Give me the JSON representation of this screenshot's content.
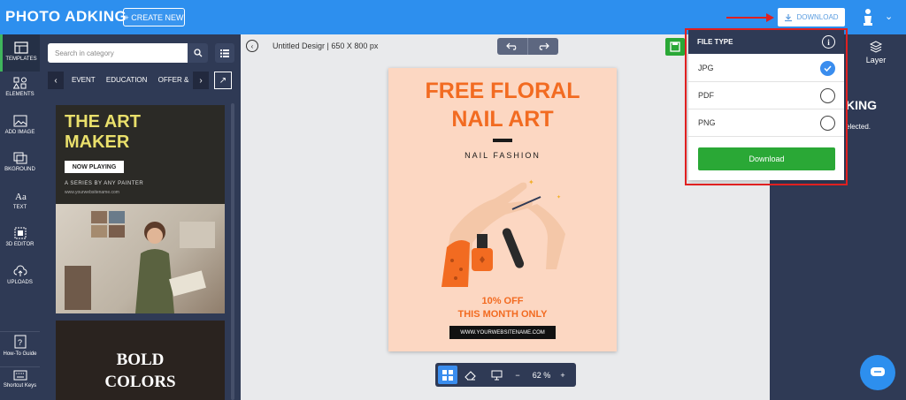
{
  "topbar": {
    "logo": "PHOTO ADKING",
    "create_new": "+ CREATE NEW",
    "download": "DOWNLOAD"
  },
  "leftnav": {
    "items": [
      {
        "label": "TEMPLATES",
        "icon": "templates-icon"
      },
      {
        "label": "ELEMENTS",
        "icon": "elements-icon"
      },
      {
        "label": "ADD IMAGE",
        "icon": "image-icon"
      },
      {
        "label": "BKGROUND",
        "icon": "background-icon"
      },
      {
        "label": "TEXT",
        "icon": "text-icon"
      },
      {
        "label": "3D EDITOR",
        "icon": "3d-editor-icon"
      },
      {
        "label": "UPLOADS",
        "icon": "upload-icon"
      }
    ],
    "howto": "How-To Guide",
    "shortcuts": "Shortcut Keys"
  },
  "panel": {
    "search_placeholder": "Search in category",
    "categories": [
      "EVENT",
      "EDUCATION",
      "OFFER & SA"
    ],
    "template1": {
      "title_line1": "THE ART",
      "title_line2": "MAKER",
      "button": "NOW PLAYING",
      "subtitle": "A SERIES BY ANY PAINTER",
      "url": "www.yourwebsitename.com"
    },
    "template2": {
      "title_line1": "BOLD",
      "title_line2": "COLORS"
    }
  },
  "editor": {
    "doc_title": "Untitled Desigr | 650 X 800 px",
    "zoom": "62 %"
  },
  "poster": {
    "title_line1": "FREE FLORAL",
    "title_line2": "NAIL ART",
    "subtitle": "NAIL FASHION",
    "offer_line1": "10% OFF",
    "offer_line2": "THIS MONTH ONLY",
    "url": "WWW.YOURWEBSITENAME.COM"
  },
  "right_panel": {
    "layer_label": "Layer",
    "behind_title": "KING",
    "behind_text": "elected."
  },
  "dropdown": {
    "header": "FILE TYPE",
    "options": [
      {
        "label": "JPG",
        "checked": true
      },
      {
        "label": "PDF",
        "checked": false
      },
      {
        "label": "PNG",
        "checked": false
      }
    ],
    "download_button": "Download"
  },
  "colors": {
    "topbar": "#2d8fee",
    "nav": "#2f3a55",
    "accent_green": "#2aa836",
    "poster_bg": "#fcd7c2",
    "poster_orange": "#f26b21",
    "highlight_red": "#e02020"
  }
}
